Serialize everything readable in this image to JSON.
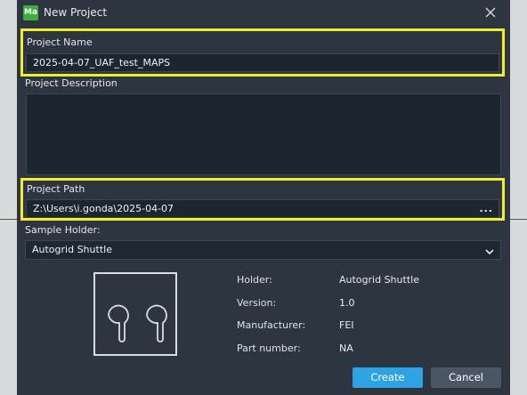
{
  "window": {
    "app_icon_text": "Ma",
    "title": "New Project",
    "close_icon": "close-icon"
  },
  "project_name": {
    "label": "Project Name",
    "value": "2025-04-07_UAF_test_MAPS"
  },
  "project_description": {
    "label": "Project Description",
    "value": ""
  },
  "project_path": {
    "label": "Project Path",
    "value": "Z:\\Users\\i.gonda\\2025-04-07",
    "browse_label": "..."
  },
  "sample_holder": {
    "label": "Sample Holder:",
    "selected": "Autogrid Shuttle"
  },
  "holder_info": {
    "holder_key": "Holder:",
    "holder_value": "Autogrid Shuttle",
    "version_key": "Version:",
    "version_value": "1.0",
    "manufacturer_key": "Manufacturer:",
    "manufacturer_value": "FEI",
    "part_key": "Part number:",
    "part_value": "NA"
  },
  "buttons": {
    "create": "Create",
    "cancel": "Cancel"
  },
  "colors": {
    "highlight": "#f1ee2a",
    "accent": "#2ea3e3",
    "app_icon": "#3cae3c"
  }
}
